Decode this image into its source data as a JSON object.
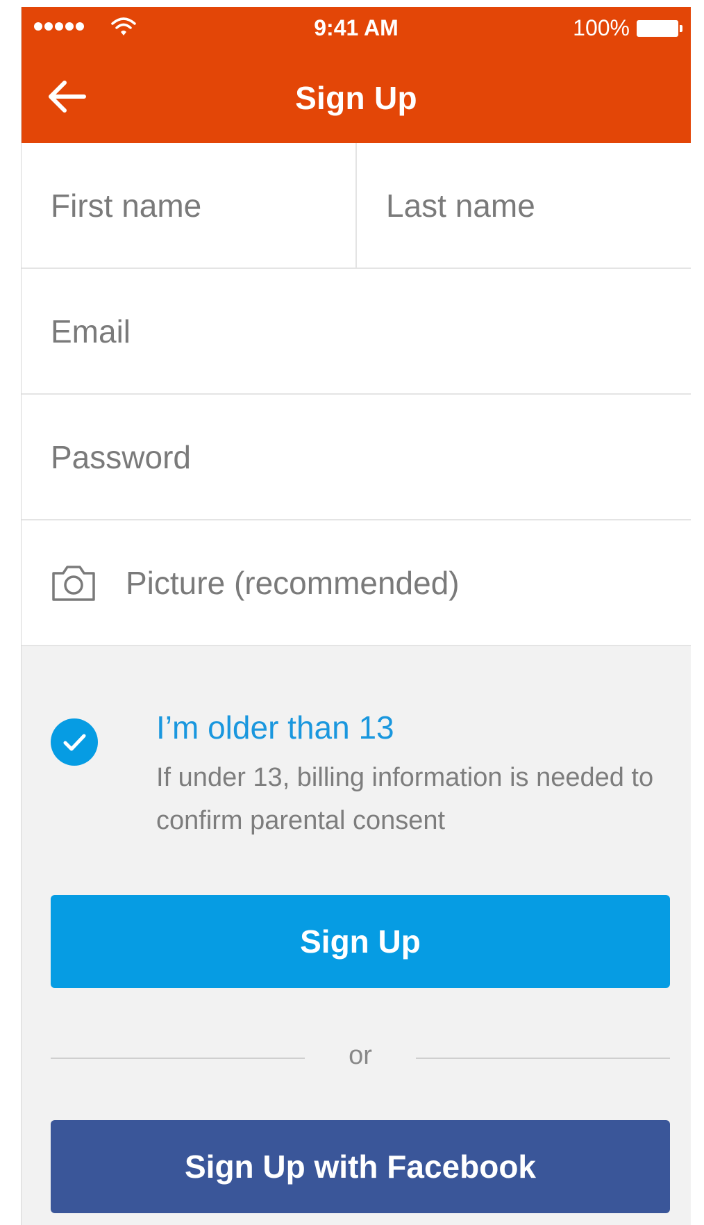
{
  "status_bar": {
    "time": "9:41 AM",
    "battery_percent": "100%",
    "signal_bars": 5
  },
  "nav": {
    "title": "Sign Up",
    "back_icon": "arrow-left-icon"
  },
  "form": {
    "first_name_placeholder": "First name",
    "last_name_placeholder": "Last name",
    "email_placeholder": "Email",
    "password_placeholder": "Password",
    "picture_placeholder": "Picture (recommended)",
    "picture_icon": "camera-icon"
  },
  "age_check": {
    "checked": true,
    "label": "I’m older than 13",
    "note": "If under 13, billing information is needed to confirm parental consent"
  },
  "buttons": {
    "signup_label": "Sign Up",
    "divider_label": "or",
    "facebook_label": "Sign Up with Facebook"
  },
  "colors": {
    "header": "#e34607",
    "primary": "#069ce3",
    "facebook": "#3a5699",
    "link_text": "#1a97de"
  }
}
